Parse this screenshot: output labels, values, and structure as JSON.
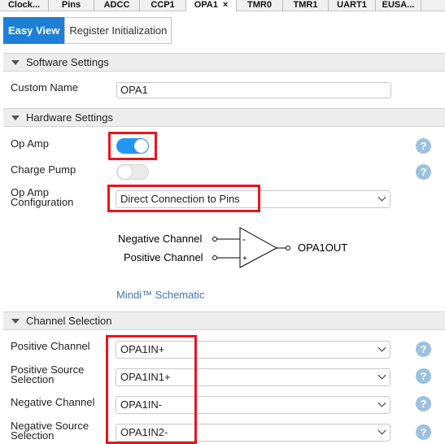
{
  "top_tabs": [
    {
      "label": "Clock...",
      "active": false,
      "closable": false
    },
    {
      "label": "Pins",
      "active": false,
      "closable": false
    },
    {
      "label": "ADCC",
      "active": false,
      "closable": false
    },
    {
      "label": "CCP1",
      "active": false,
      "closable": false
    },
    {
      "label": "OPA1",
      "active": true,
      "closable": true
    },
    {
      "label": "TMR0",
      "active": false,
      "closable": false
    },
    {
      "label": "TMR1",
      "active": false,
      "closable": false
    },
    {
      "label": "UART1",
      "active": false,
      "closable": false
    },
    {
      "label": "EUSA...",
      "active": false,
      "closable": false
    }
  ],
  "close_glyph": "×",
  "view_tabs": {
    "easy_view": "Easy View",
    "register_init": "Register Initialization"
  },
  "software_settings": {
    "title": "Software Settings",
    "custom_name_label": "Custom Name",
    "custom_name_value": "OPA1"
  },
  "hardware_settings": {
    "title": "Hardware Settings",
    "op_amp_label": "Op Amp",
    "op_amp_on": true,
    "charge_pump_label": "Charge Pump",
    "charge_pump_on": false,
    "config_label_line1": "Op Amp",
    "config_label_line2": "Configuration",
    "config_value": "Direct Connection to Pins"
  },
  "schematic": {
    "negative_channel": "Negative Channel",
    "positive_channel": "Positive Channel",
    "minus_sign": "-",
    "plus_sign": "+",
    "output": "OPA1OUT",
    "link": "Mindi™ Schematic"
  },
  "channel_selection": {
    "title": "Channel Selection",
    "positive_channel_label": "Positive Channel",
    "positive_channel_value": "OPA1IN+",
    "positive_source_line1": "Positive Source",
    "positive_source_line2": "Selection",
    "positive_source_value": "OPA1IN1+",
    "negative_channel_label": "Negative Channel",
    "negative_channel_value": "OPA1IN-",
    "negative_source_line1": "Negative Source",
    "negative_source_line2": "Selection",
    "negative_source_value": "OPA1IN2-"
  },
  "help_glyph": "?",
  "colors": {
    "accent": "#1d7fd6",
    "toggle_on": "#2196f3",
    "highlight_box": "#e8151b",
    "help_icon": "#9dc1df",
    "link": "#3a78b5"
  }
}
